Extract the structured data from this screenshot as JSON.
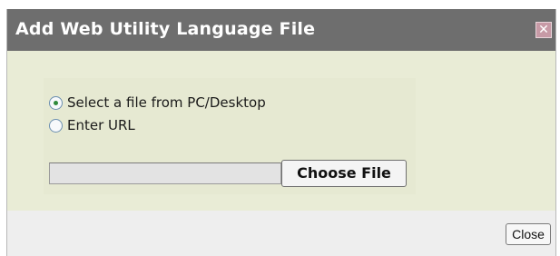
{
  "dialog": {
    "title": "Add Web Utility Language File",
    "close_icon_glyph": "✕"
  },
  "source_options": [
    {
      "label": "Select a file from PC/Desktop",
      "selected": true
    },
    {
      "label": "Enter URL",
      "selected": false
    }
  ],
  "file_picker": {
    "value": "",
    "button_label": "Choose File"
  },
  "footer": {
    "close_label": "Close"
  },
  "colors": {
    "titlebar": "#6e6e6e",
    "body_background": "#e9ecd6",
    "radio_selected": "#2f8a3a"
  }
}
